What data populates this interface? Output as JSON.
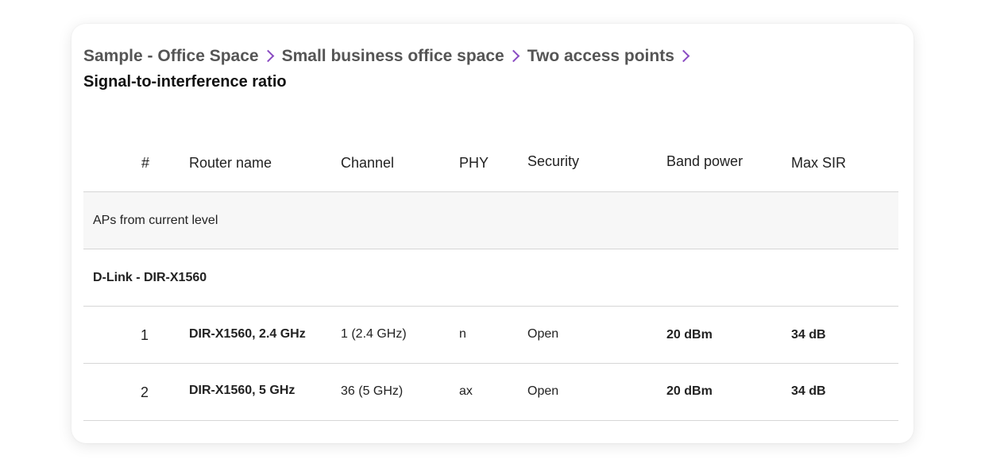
{
  "breadcrumb": {
    "items": [
      {
        "label": "Sample - Office Space"
      },
      {
        "label": "Small business office space"
      },
      {
        "label": "Two access points"
      }
    ]
  },
  "page_title": "Signal-to-interference ratio",
  "table": {
    "columns": [
      "#",
      "Router name",
      "Channel",
      "PHY",
      "Security",
      "Band power",
      "Max SIR"
    ],
    "group_label": "APs from current level",
    "router_label": "D-Link - DIR-X1560",
    "rows": [
      {
        "num": "1",
        "name": "DIR-X1560, 2.4 GHz",
        "channel": "1 (2.4 GHz)",
        "phy": "n",
        "security": "Open",
        "band_power": "20 dBm",
        "max_sir": "34 dB"
      },
      {
        "num": "2",
        "name": "DIR-X1560, 5 GHz",
        "channel": "36 (5 GHz)",
        "phy": "ax",
        "security": "Open",
        "band_power": "20 dBm",
        "max_sir": "34 dB"
      }
    ]
  },
  "colors": {
    "chevron": "#8a4bc2",
    "group_row_bg": "#f7f7f7",
    "divider": "#d6d6d6"
  }
}
